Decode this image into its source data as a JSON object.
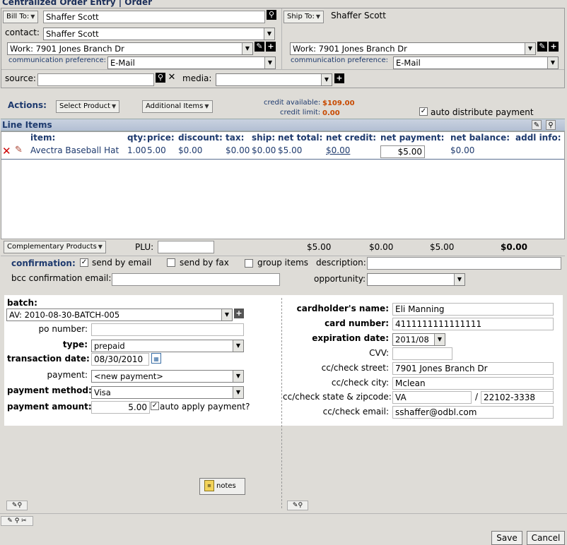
{
  "window": {
    "title": "Centralized Order Entry | Order"
  },
  "bill_to": {
    "button": "Bill To:",
    "name": "Shaffer Scott",
    "contact_label": "contact:",
    "contact": "Shaffer Scott",
    "address": "Work: 7901 Jones Branch Dr",
    "comm_pref_label": "communication preference:",
    "comm_pref": "E-Mail"
  },
  "ship_to": {
    "button": "Ship To:",
    "name": "Shaffer Scott",
    "address": "Work: 7901 Jones Branch Dr",
    "comm_pref_label": "communication preference:",
    "comm_pref": "E-Mail"
  },
  "source": {
    "label": "source:",
    "value": "",
    "media_label": "media:",
    "media_value": ""
  },
  "actions": {
    "label": "Actions:",
    "select_product": "Select Product",
    "additional_items": "Additional Items",
    "credit_available_label": "credit available:",
    "credit_available": "$109.00",
    "credit_limit_label": "credit limit:",
    "credit_limit": "0.00",
    "auto_distribute_label": "auto distribute payment",
    "auto_distribute_checked": true
  },
  "line_items": {
    "title": "Line Items",
    "columns": [
      "item:",
      "qty:",
      "price:",
      "discount:",
      "tax:",
      "ship:",
      "net total:",
      "net credit:",
      "net payment:",
      "net balance:",
      "addl info:"
    ],
    "rows": [
      {
        "item": "Avectra Baseball Hat",
        "qty": "1.00",
        "price": "5.00",
        "discount": "$0.00",
        "tax": "$0.00",
        "ship": "$0.00",
        "net_total": "$5.00",
        "net_credit": "$0.00",
        "net_payment": "$5.00",
        "net_balance": "$0.00"
      }
    ]
  },
  "totals": {
    "complementary_products": "Complementary Products",
    "plu_label": "PLU:",
    "plu_value": "",
    "net_total": "$5.00",
    "net_credit": "$0.00",
    "net_payment": "$5.00",
    "net_balance": "$0.00"
  },
  "confirmation": {
    "label": "confirmation:",
    "send_by_email": "send by email",
    "send_by_email_checked": true,
    "send_by_fax": "send by fax",
    "group_items": "group items",
    "description_label": "description:",
    "description": "",
    "bcc_label": "bcc confirmation email:",
    "bcc": "",
    "opportunity_label": "opportunity:",
    "opportunity": ""
  },
  "payment": {
    "batch_label": "batch:",
    "batch": "AV: 2010-08-30-BATCH-005",
    "po_label": "po number:",
    "po": "",
    "type_label": "type:",
    "type": "prepaid",
    "transaction_date_label": "transaction date:",
    "transaction_date": "08/30/2010",
    "payment_label": "payment:",
    "payment": "<new payment>",
    "method_label": "payment method:",
    "method": "Visa",
    "amount_label": "payment amount:",
    "amount": "5.00",
    "auto_apply_label": "auto apply payment?",
    "auto_apply_checked": true
  },
  "card": {
    "holder_label": "cardholder's name:",
    "holder": "Eli Manning",
    "number_label": "card number:",
    "number": "4111111111111111",
    "expiration_label": "expiration date:",
    "expiration": "2011/08",
    "cvv_label": "CVV:",
    "cvv": "",
    "street_label": "cc/check street:",
    "street": "7901 Jones Branch Dr",
    "city_label": "cc/check city:",
    "city": "Mclean",
    "state_zip_label": "cc/check state & zipcode:",
    "state": "VA",
    "zip_sep": "/",
    "zip": "22102-3338",
    "email_label": "cc/check email:",
    "email": "sshaffer@odbl.com"
  },
  "footer": {
    "notes": "notes",
    "save": "Save",
    "cancel": "Cancel"
  }
}
